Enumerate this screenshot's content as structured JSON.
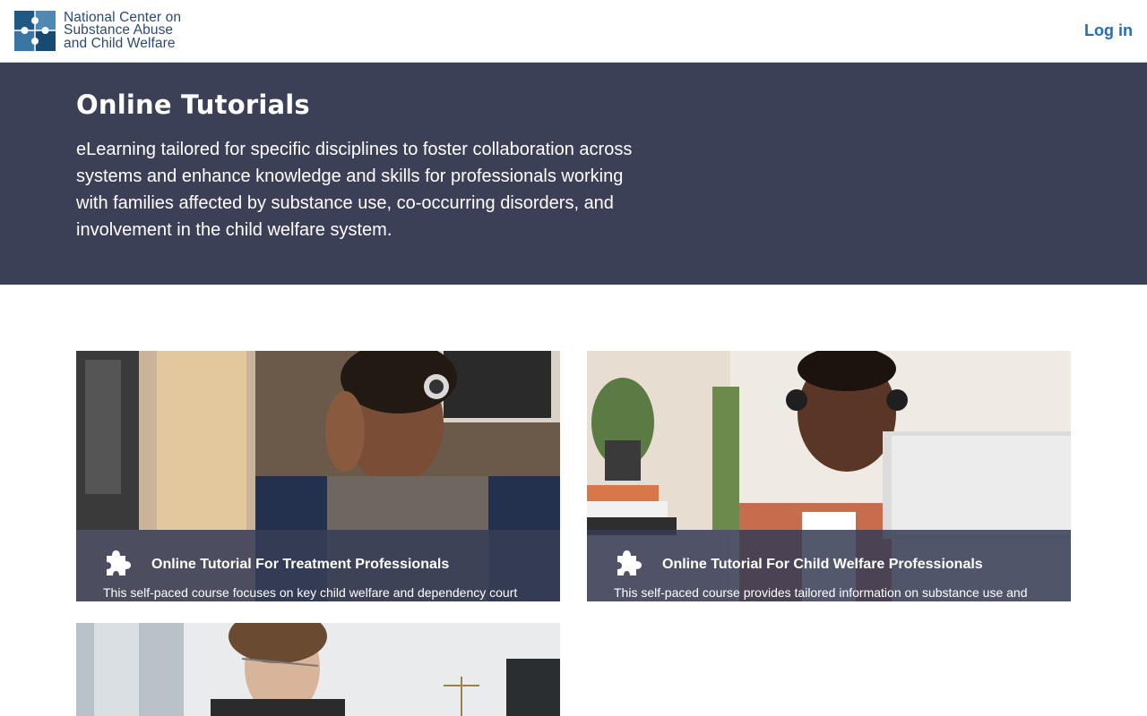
{
  "header": {
    "logo_lines": [
      "National Center on",
      "Substance Abuse",
      "and Child Welfare"
    ],
    "logo_icon": "puzzle-logo-icon",
    "login_label": "Log in"
  },
  "hero": {
    "title": "Online Tutorials",
    "description": "eLearning tailored for specific disciplines to foster collaboration across systems and enhance knowledge and skills for professionals working with families affected by substance use, co-occurring disorders, and involvement in the child welfare system.",
    "background_color": "#3b4057"
  },
  "cards": [
    {
      "title": "Online Tutorial For Treatment Professionals",
      "description": "This self-paced course focuses on key child welfare and dependency court",
      "icon": "puzzle-piece-icon",
      "image": "woman-with-headphones-photo"
    },
    {
      "title": "Online Tutorial For Child Welfare Professionals",
      "description": "This self-paced course provides tailored information on substance use and",
      "icon": "puzzle-piece-icon",
      "image": "man-with-headphones-photo"
    },
    {
      "title": "",
      "description": "",
      "image": "woman-with-glasses-photo"
    }
  ],
  "colors": {
    "brand_blue": "#2d4a73",
    "link_blue": "#1d6fba",
    "hero_bg": "#3b4057"
  }
}
